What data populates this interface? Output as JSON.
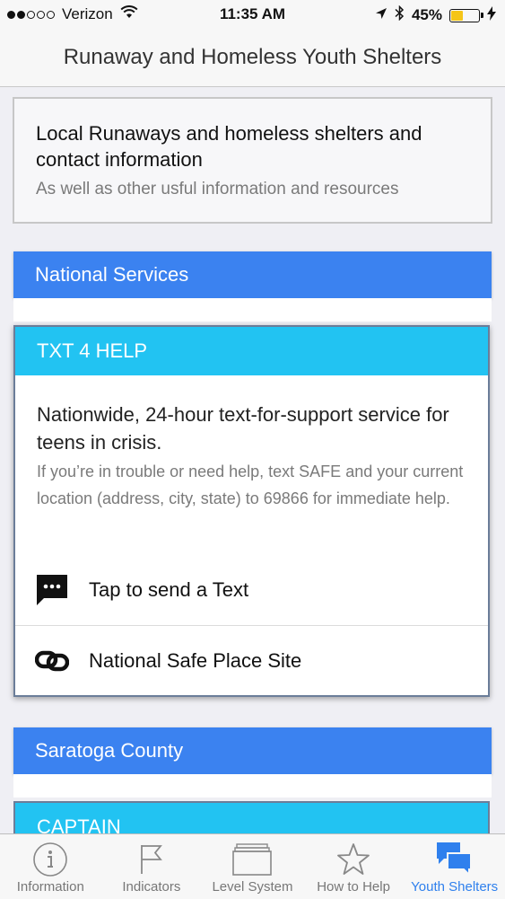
{
  "status_bar": {
    "carrier": "Verizon",
    "time": "11:35 AM",
    "battery": "45%",
    "battery_level": 0.45
  },
  "navbar": {
    "title": "Runaway and Homeless Youth Shelters"
  },
  "intro": {
    "heading": "Local Runaways and homeless shelters and contact information",
    "subtitle": "As well as other usful information and resources"
  },
  "sections": [
    {
      "header": "National Services",
      "card": {
        "title": "TXT 4 HELP",
        "lead": "Nationwide, 24-hour text-for-support service for teens in crisis.",
        "description": "If you’re in trouble or need help, text SAFE and your current location (address, city, state) to 69866 for immediate help.",
        "actions": [
          {
            "label": "Tap to send a Text",
            "icon": "message-icon"
          },
          {
            "label": "National Safe Place Site",
            "icon": "link-icon"
          }
        ]
      }
    },
    {
      "header": "Saratoga County",
      "card": {
        "title": "CAPTAIN"
      }
    }
  ],
  "tab_bar": {
    "tabs": [
      {
        "label": "Information",
        "icon": "info-icon",
        "active": false
      },
      {
        "label": "Indicators",
        "icon": "flag-icon",
        "active": false
      },
      {
        "label": "Level System",
        "icon": "stack-icon",
        "active": false
      },
      {
        "label": "How to Help",
        "icon": "star-icon",
        "active": false
      },
      {
        "label": "Youth Shelters",
        "icon": "chat-bubbles-icon",
        "active": true
      }
    ]
  },
  "colors": {
    "section_header": "#3b82f0",
    "card_header": "#22c3f2",
    "active_tab": "#2f80ed",
    "battery_fill": "#f5c518"
  }
}
